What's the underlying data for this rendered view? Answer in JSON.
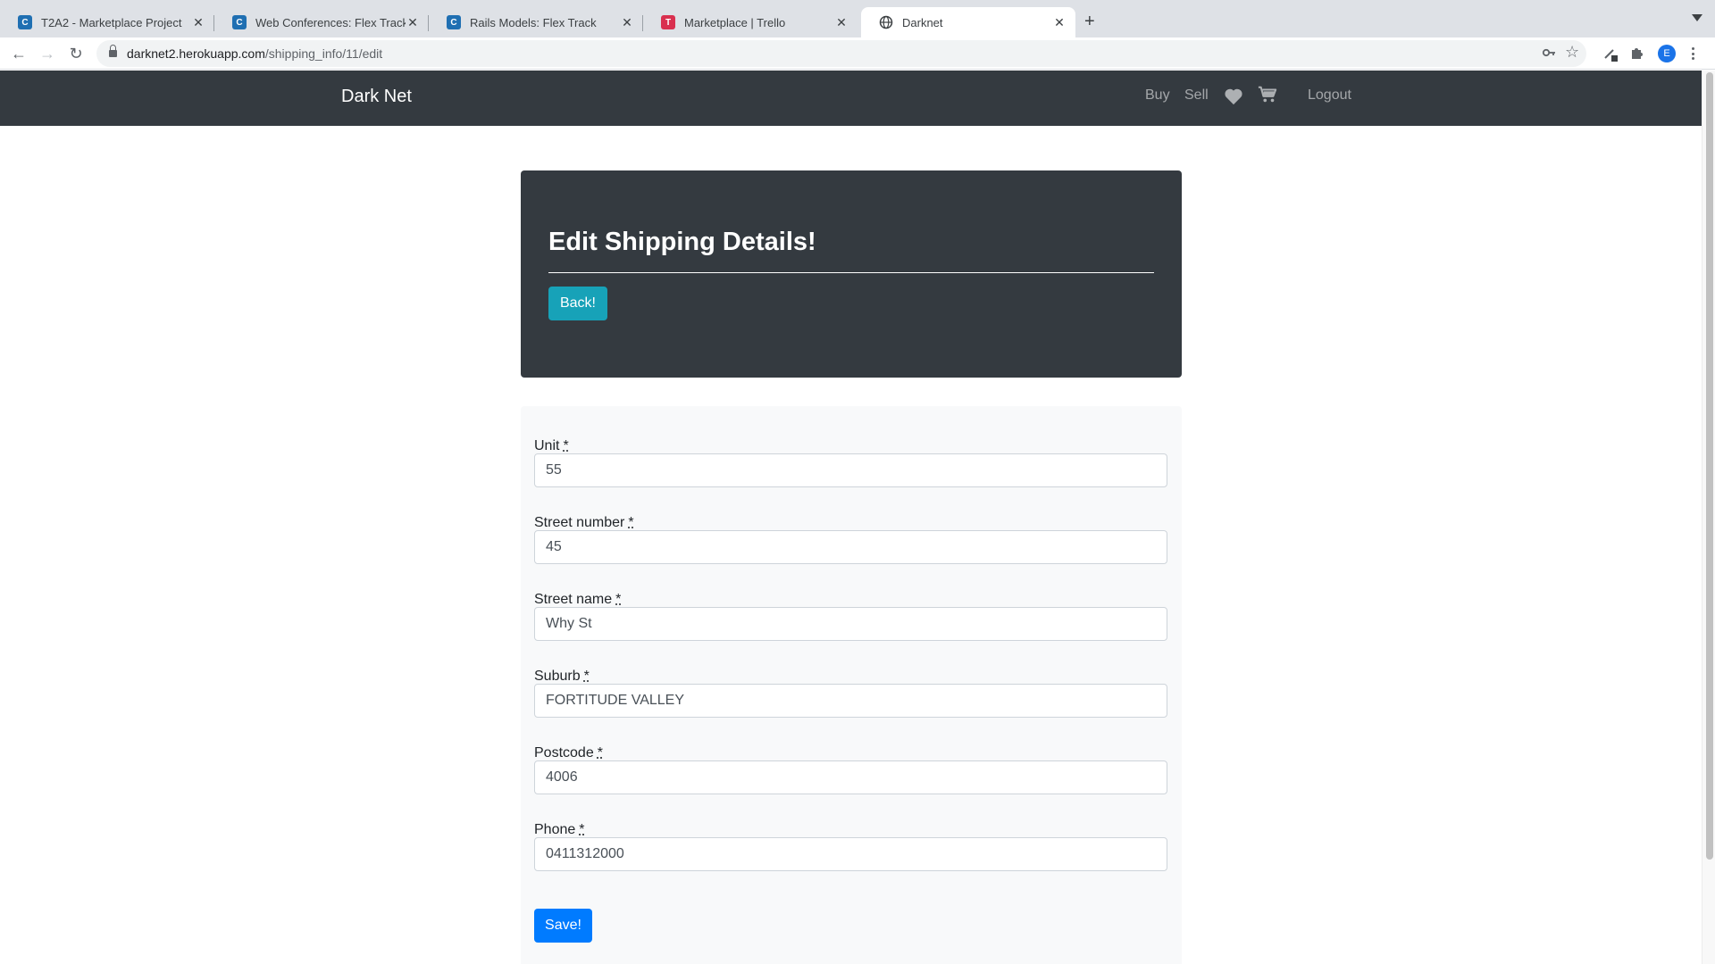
{
  "browser": {
    "tabs": [
      {
        "title": "T2A2 - Marketplace Project",
        "icon": "canvas-icon",
        "close": "✕"
      },
      {
        "title": "Web Conferences: Flex Track",
        "icon": "canvas-icon",
        "close": "✕"
      },
      {
        "title": "Rails Models: Flex Track",
        "icon": "canvas-icon",
        "close": "✕"
      },
      {
        "title": "Marketplace | Trello",
        "icon": "trello-icon",
        "close": "✕"
      },
      {
        "title": "Darknet",
        "icon": "globe-icon",
        "close": "✕"
      }
    ],
    "new_tab": "+",
    "url_host": "darknet2.herokuapp.com",
    "url_path": "/shipping_info/11/edit",
    "profile_initial": "E"
  },
  "site": {
    "brand": "Dark Net",
    "nav": {
      "buy": "Buy",
      "sell": "Sell",
      "logout": "Logout"
    }
  },
  "page": {
    "title": "Edit Shipping Details!",
    "back_button": "Back!",
    "save_button": "Save!",
    "required_marker": "*"
  },
  "form": {
    "fields": [
      {
        "label": "Unit",
        "value": "55"
      },
      {
        "label": "Street number",
        "value": "45"
      },
      {
        "label": "Street name",
        "value": "Why St"
      },
      {
        "label": "Suburb",
        "value": "FORTITUDE VALLEY"
      },
      {
        "label": "Postcode",
        "value": "4006"
      },
      {
        "label": "Phone",
        "value": "0411312000"
      }
    ]
  },
  "colors": {
    "navbar": "#343a40",
    "back_button": "#17a2b8",
    "save_button": "#007bff",
    "form_background": "#f8f9fa"
  }
}
